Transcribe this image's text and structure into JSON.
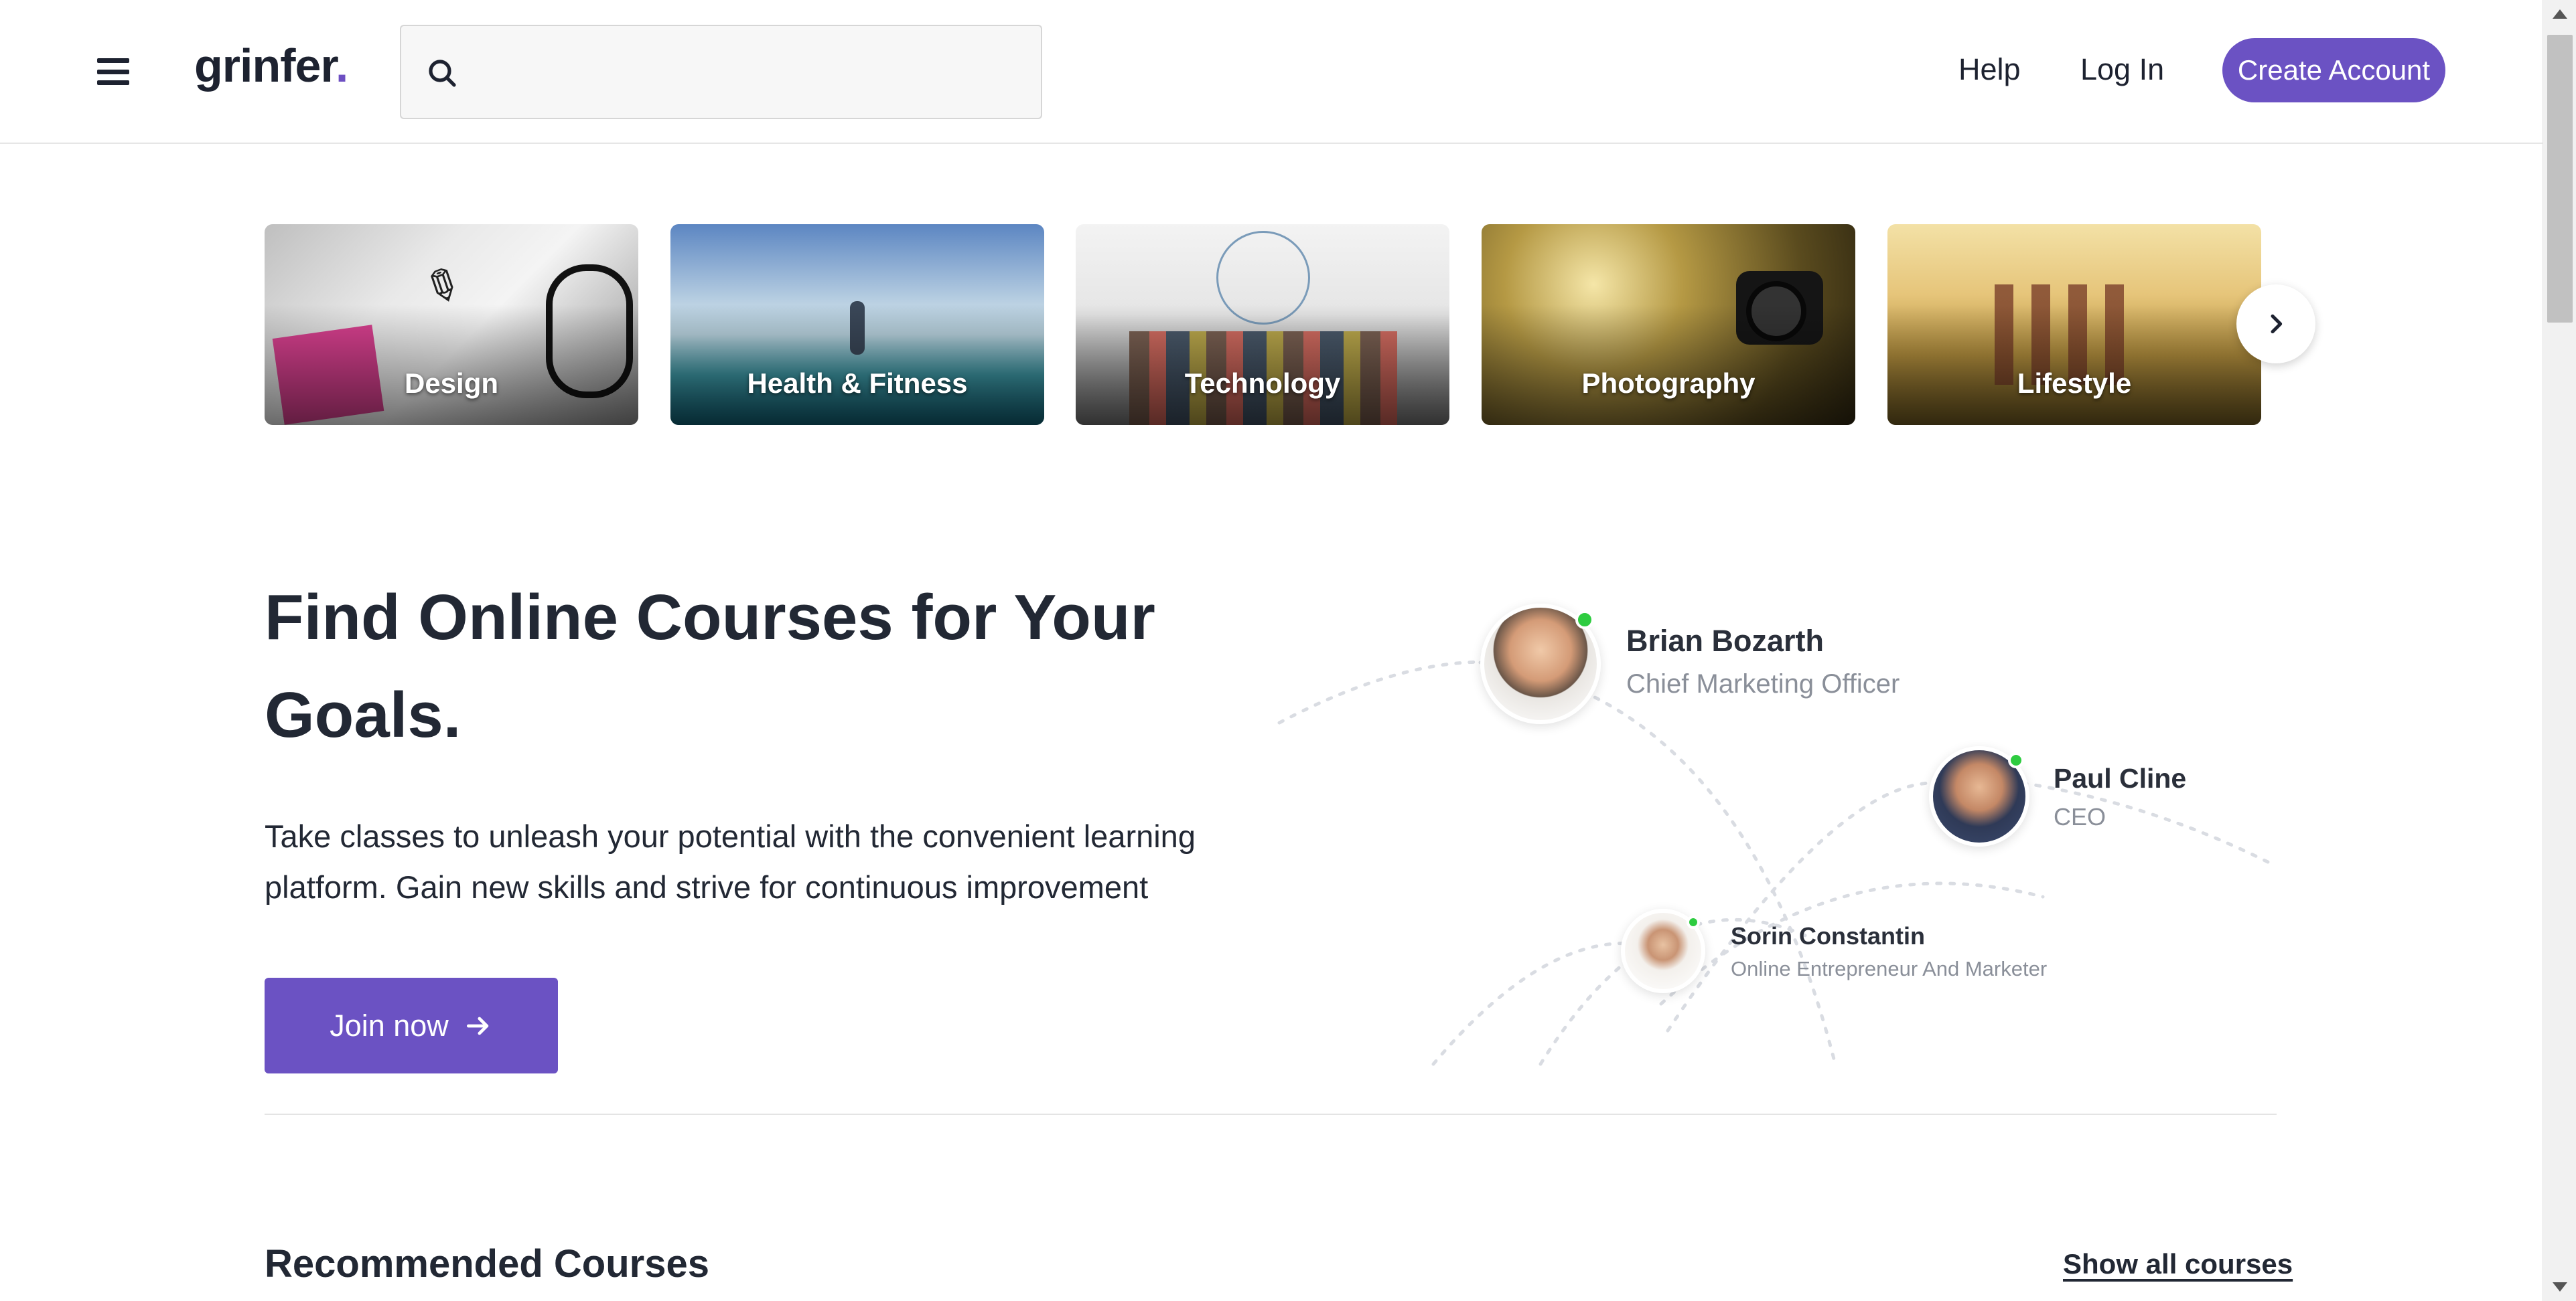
{
  "header": {
    "logo_text": "grinfer",
    "logo_dot": ".",
    "search_placeholder": "",
    "help_label": "Help",
    "login_label": "Log In",
    "create_account_label": "Create Account"
  },
  "categories": [
    {
      "label": "Design"
    },
    {
      "label": "Health & Fitness"
    },
    {
      "label": "Technology"
    },
    {
      "label": "Photography"
    },
    {
      "label": "Lifestyle"
    }
  ],
  "hero": {
    "title": "Find Online Courses for Your Goals.",
    "subtitle": "Take classes to unleash your potential with the convenient learning platform. Gain new skills and strive for continuous improvement",
    "join_label": "Join now"
  },
  "testimonials": [
    {
      "name": "Brian Bozarth",
      "role": "Chief Marketing Officer"
    },
    {
      "name": "Paul Cline",
      "role": "CEO"
    },
    {
      "name": "Sorin Constantin",
      "role": "Online Entrepreneur And Marketer"
    }
  ],
  "recommended": {
    "title": "Recommended Courses",
    "show_all_label": "Show all courses"
  },
  "colors": {
    "brand": "#6b52c3",
    "text": "#222834",
    "online": "#2ecc40"
  }
}
